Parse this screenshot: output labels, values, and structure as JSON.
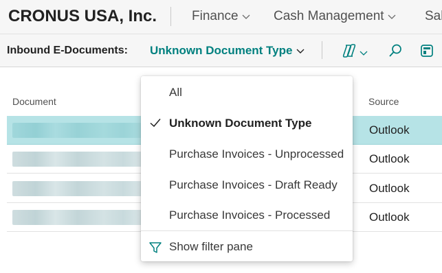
{
  "app": {
    "company": "CRONUS USA, Inc.",
    "nav": [
      {
        "label": "Finance"
      },
      {
        "label": "Cash Management"
      },
      {
        "label": "Sal"
      }
    ]
  },
  "actionbar": {
    "page_caption": "Inbound E-Documents:",
    "view_selector": "Unknown Document Type",
    "icons": [
      "copilot-icon",
      "search-icon",
      "layout-icon"
    ]
  },
  "list": {
    "columns": {
      "document": "Document",
      "source": "Source"
    },
    "rows": [
      {
        "source": "Outlook",
        "selected": true
      },
      {
        "source": "Outlook",
        "selected": false
      },
      {
        "source": "Outlook",
        "selected": false
      },
      {
        "source": "Outlook",
        "selected": false
      }
    ]
  },
  "dropdown": {
    "items": [
      {
        "label": "All",
        "checked": false
      },
      {
        "label": "Unknown Document Type",
        "checked": true
      },
      {
        "label": "Purchase Invoices - Unprocessed",
        "checked": false
      },
      {
        "label": "Purchase Invoices - Draft Ready",
        "checked": false
      },
      {
        "label": "Purchase Invoices - Processed",
        "checked": false
      }
    ],
    "filter_pane": "Show filter pane"
  },
  "colors": {
    "accent": "#00807f",
    "selected_row": "#b6e3e6",
    "bar_background": "#f6f6f6"
  }
}
